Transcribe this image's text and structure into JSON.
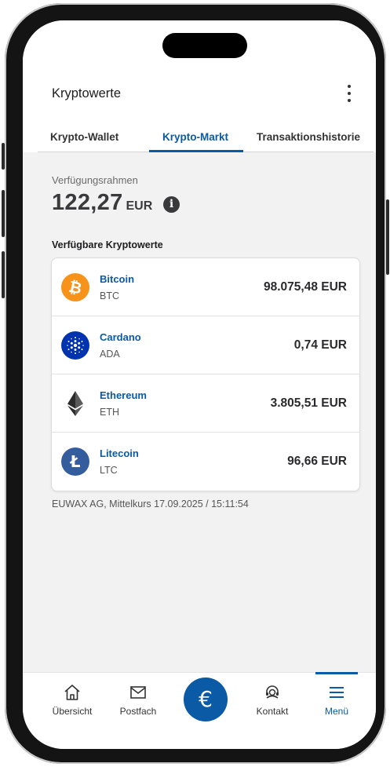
{
  "header": {
    "title": "Kryptowerte"
  },
  "tabs": [
    {
      "label": "Krypto-Wallet"
    },
    {
      "label": "Krypto-Markt"
    },
    {
      "label": "Transaktionshistorie"
    }
  ],
  "balance": {
    "label": "Verfügungsrahmen",
    "amount": "122,27",
    "currency": "EUR",
    "info_glyph": "i"
  },
  "section_title": "Verfügbare Kryptowerte",
  "coins": [
    {
      "name": "Bitcoin",
      "symbol": "BTC",
      "price": "98.075,48 EUR",
      "icon": "bitcoin-icon",
      "color": "#f7931a",
      "glyph": "₿"
    },
    {
      "name": "Cardano",
      "symbol": "ADA",
      "price": "0,74 EUR",
      "icon": "cardano-icon",
      "color": "#0033ad",
      "glyph": ""
    },
    {
      "name": "Ethereum",
      "symbol": "ETH",
      "price": "3.805,51 EUR",
      "icon": "ethereum-icon",
      "color": "#2b2b2b",
      "glyph": ""
    },
    {
      "name": "Litecoin",
      "symbol": "LTC",
      "price": "96,66 EUR",
      "icon": "litecoin-icon",
      "color": "#345d9d",
      "glyph": "Ł"
    }
  ],
  "footnote": "EUWAX AG, Mittelkurs 17.09.2025 / 15:11:54",
  "nav": {
    "items": [
      {
        "label": "Übersicht",
        "icon": "home-icon"
      },
      {
        "label": "Postfach",
        "icon": "mail-icon"
      },
      {
        "label": "",
        "icon": "euro-icon",
        "glyph": "€"
      },
      {
        "label": "Kontakt",
        "icon": "headset-icon"
      },
      {
        "label": "Menü",
        "icon": "menu-icon"
      }
    ]
  },
  "colors": {
    "accent": "#0a5aa5",
    "background": "#f2f2f3"
  }
}
